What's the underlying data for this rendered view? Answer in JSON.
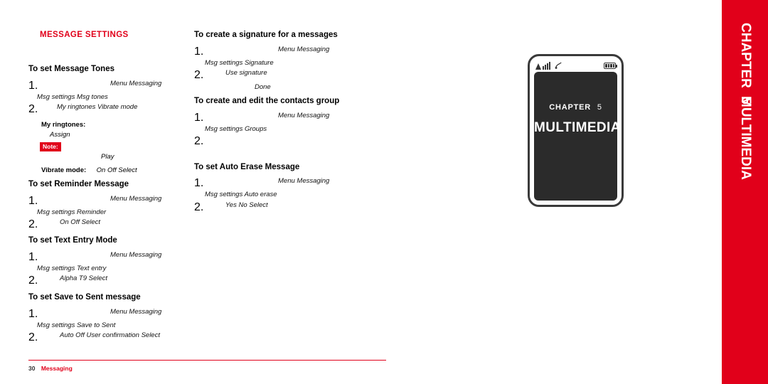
{
  "sidebar": {
    "chapter_label": "CHAPTER",
    "chapter_number": "5",
    "title": "MULTIMEDIA",
    "color": "#e1001a"
  },
  "phone": {
    "status_signal_icon": "signal-bars-icon",
    "status_battery_icon": "battery-icon",
    "screen_chapter_label": "CHAPTER",
    "screen_chapter_number": "5",
    "screen_title": "MULTIMEDIA"
  },
  "document": {
    "section_heading": "MESSAGE SETTINGS",
    "footer_page": "30",
    "footer_label": "Messaging",
    "left_column": [
      {
        "title": "To set Message Tones",
        "steps": [
          {
            "num": "1.",
            "path": "Menu    Messaging",
            "path2": "Msg settings    Msg tones"
          },
          {
            "num": "2.",
            "path": "My ringtones    Vibrate mode"
          }
        ],
        "extra": [
          {
            "label": "My ringtones:",
            "value": "Assign"
          },
          {
            "note": "Note:",
            "value": "Play"
          },
          {
            "label": "Vibrate mode:",
            "value": "On    Off    Select"
          }
        ]
      },
      {
        "title": "To set Reminder Message",
        "steps": [
          {
            "num": "1.",
            "path": "Menu    Messaging",
            "path2": "Msg settings    Reminder"
          },
          {
            "num": "2.",
            "path": "On    Off    Select"
          }
        ]
      },
      {
        "title": "To set Text Entry Mode",
        "steps": [
          {
            "num": "1.",
            "path": "Menu    Messaging",
            "path2": "Msg settings    Text entry"
          },
          {
            "num": "2.",
            "path": "Alpha    T9    Select"
          }
        ]
      },
      {
        "title": "To set Save to Sent message",
        "steps": [
          {
            "num": "1.",
            "path": "Menu    Messaging",
            "path2": "Msg settings    Save to Sent"
          },
          {
            "num": "2.",
            "path": "Auto  Off      User confirmation    Select"
          }
        ]
      }
    ],
    "right_column": [
      {
        "title": "To create a signature for a messages",
        "steps": [
          {
            "num": "1.",
            "path": "Menu    Messaging",
            "path2": "Msg settings    Signature"
          },
          {
            "num": "2.",
            "path": "Use signature",
            "path2": "Done"
          }
        ]
      },
      {
        "title": "To create and edit the contacts group",
        "steps": [
          {
            "num": "1.",
            "path": "Menu    Messaging",
            "path2": "Msg settings    Groups"
          },
          {
            "num": "2.",
            "path": ""
          }
        ]
      },
      {
        "title": "To set Auto Erase Message",
        "steps": [
          {
            "num": "1.",
            "path": "Menu    Messaging",
            "path2": "Msg settings    Auto erase"
          },
          {
            "num": "2.",
            "path": "Yes    No    Select"
          }
        ]
      }
    ]
  }
}
